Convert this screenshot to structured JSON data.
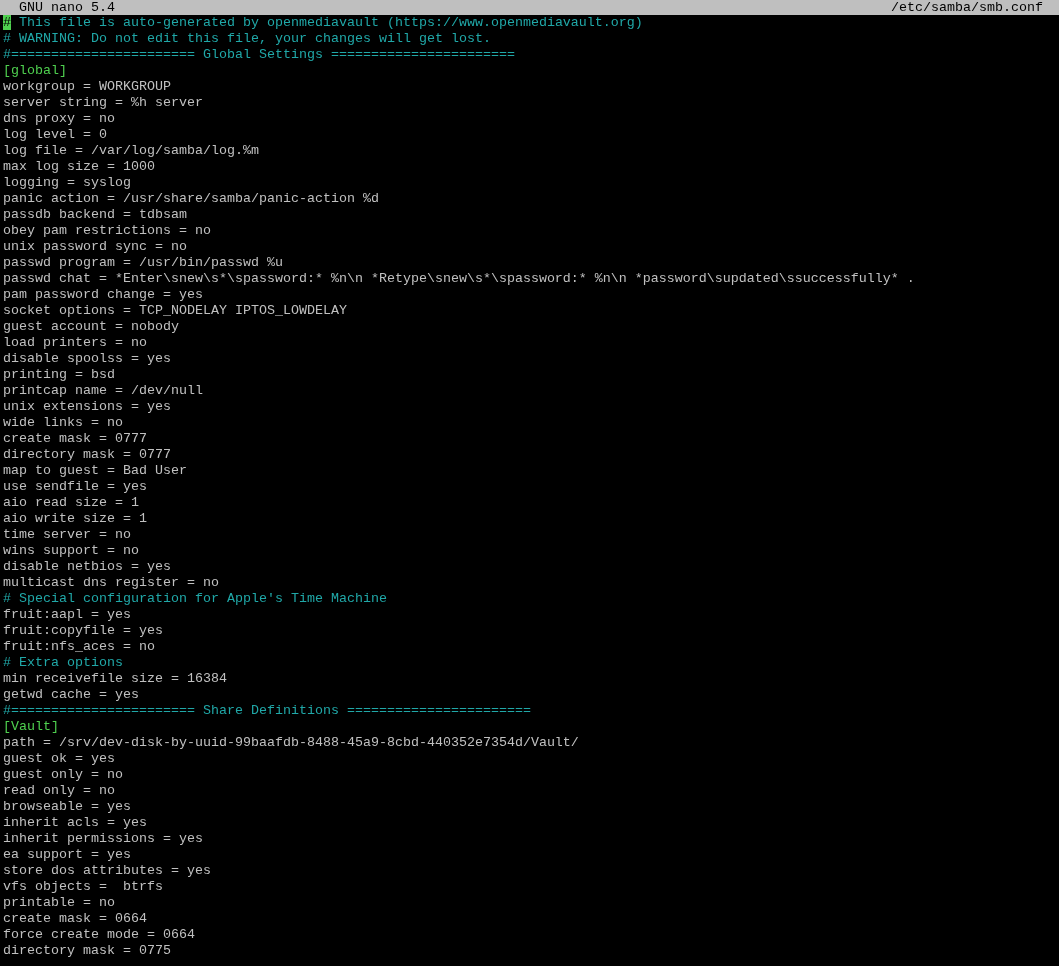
{
  "title_bar": {
    "program": "GNU nano 5.4",
    "file": "/etc/samba/smb.conf"
  },
  "lines": [
    {
      "kind": "comment",
      "text": "# This file is auto-generated by openmediavault (https://www.openmediavault.org)",
      "cursor": true
    },
    {
      "kind": "comment",
      "text": "# WARNING: Do not edit this file, your changes will get lost.",
      "cursor": false
    },
    {
      "kind": "comment",
      "text": "#======================= Global Settings =======================",
      "cursor": false
    },
    {
      "kind": "section",
      "text": "[global]",
      "cursor": false
    },
    {
      "kind": "setting",
      "text": "workgroup = WORKGROUP",
      "cursor": false
    },
    {
      "kind": "setting",
      "text": "server string = %h server",
      "cursor": false
    },
    {
      "kind": "setting",
      "text": "dns proxy = no",
      "cursor": false
    },
    {
      "kind": "setting",
      "text": "log level = 0",
      "cursor": false
    },
    {
      "kind": "setting",
      "text": "log file = /var/log/samba/log.%m",
      "cursor": false
    },
    {
      "kind": "setting",
      "text": "max log size = 1000",
      "cursor": false
    },
    {
      "kind": "setting",
      "text": "logging = syslog",
      "cursor": false
    },
    {
      "kind": "setting",
      "text": "panic action = /usr/share/samba/panic-action %d",
      "cursor": false
    },
    {
      "kind": "setting",
      "text": "passdb backend = tdbsam",
      "cursor": false
    },
    {
      "kind": "setting",
      "text": "obey pam restrictions = no",
      "cursor": false
    },
    {
      "kind": "setting",
      "text": "unix password sync = no",
      "cursor": false
    },
    {
      "kind": "setting",
      "text": "passwd program = /usr/bin/passwd %u",
      "cursor": false
    },
    {
      "kind": "setting",
      "text": "passwd chat = *Enter\\snew\\s*\\spassword:* %n\\n *Retype\\snew\\s*\\spassword:* %n\\n *password\\supdated\\ssuccessfully* .",
      "cursor": false
    },
    {
      "kind": "setting",
      "text": "pam password change = yes",
      "cursor": false
    },
    {
      "kind": "setting",
      "text": "socket options = TCP_NODELAY IPTOS_LOWDELAY",
      "cursor": false
    },
    {
      "kind": "setting",
      "text": "guest account = nobody",
      "cursor": false
    },
    {
      "kind": "setting",
      "text": "load printers = no",
      "cursor": false
    },
    {
      "kind": "setting",
      "text": "disable spoolss = yes",
      "cursor": false
    },
    {
      "kind": "setting",
      "text": "printing = bsd",
      "cursor": false
    },
    {
      "kind": "setting",
      "text": "printcap name = /dev/null",
      "cursor": false
    },
    {
      "kind": "setting",
      "text": "unix extensions = yes",
      "cursor": false
    },
    {
      "kind": "setting",
      "text": "wide links = no",
      "cursor": false
    },
    {
      "kind": "setting",
      "text": "create mask = 0777",
      "cursor": false
    },
    {
      "kind": "setting",
      "text": "directory mask = 0777",
      "cursor": false
    },
    {
      "kind": "setting",
      "text": "map to guest = Bad User",
      "cursor": false
    },
    {
      "kind": "setting",
      "text": "use sendfile = yes",
      "cursor": false
    },
    {
      "kind": "setting",
      "text": "aio read size = 1",
      "cursor": false
    },
    {
      "kind": "setting",
      "text": "aio write size = 1",
      "cursor": false
    },
    {
      "kind": "setting",
      "text": "time server = no",
      "cursor": false
    },
    {
      "kind": "setting",
      "text": "wins support = no",
      "cursor": false
    },
    {
      "kind": "setting",
      "text": "disable netbios = yes",
      "cursor": false
    },
    {
      "kind": "setting",
      "text": "multicast dns register = no",
      "cursor": false
    },
    {
      "kind": "comment",
      "text": "# Special configuration for Apple's Time Machine",
      "cursor": false
    },
    {
      "kind": "setting",
      "text": "fruit:aapl = yes",
      "cursor": false
    },
    {
      "kind": "setting",
      "text": "fruit:copyfile = yes",
      "cursor": false
    },
    {
      "kind": "setting",
      "text": "fruit:nfs_aces = no",
      "cursor": false
    },
    {
      "kind": "comment",
      "text": "# Extra options",
      "cursor": false
    },
    {
      "kind": "setting",
      "text": "min receivefile size = 16384",
      "cursor": false
    },
    {
      "kind": "setting",
      "text": "getwd cache = yes",
      "cursor": false
    },
    {
      "kind": "comment",
      "text": "#======================= Share Definitions =======================",
      "cursor": false
    },
    {
      "kind": "section",
      "text": "[Vault]",
      "cursor": false
    },
    {
      "kind": "setting",
      "text": "path = /srv/dev-disk-by-uuid-99baafdb-8488-45a9-8cbd-440352e7354d/Vault/",
      "cursor": false
    },
    {
      "kind": "setting",
      "text": "guest ok = yes",
      "cursor": false
    },
    {
      "kind": "setting",
      "text": "guest only = no",
      "cursor": false
    },
    {
      "kind": "setting",
      "text": "read only = no",
      "cursor": false
    },
    {
      "kind": "setting",
      "text": "browseable = yes",
      "cursor": false
    },
    {
      "kind": "setting",
      "text": "inherit acls = yes",
      "cursor": false
    },
    {
      "kind": "setting",
      "text": "inherit permissions = yes",
      "cursor": false
    },
    {
      "kind": "setting",
      "text": "ea support = yes",
      "cursor": false
    },
    {
      "kind": "setting",
      "text": "store dos attributes = yes",
      "cursor": false
    },
    {
      "kind": "setting",
      "text": "vfs objects =  btrfs",
      "cursor": false
    },
    {
      "kind": "setting",
      "text": "printable = no",
      "cursor": false
    },
    {
      "kind": "setting",
      "text": "create mask = 0664",
      "cursor": false
    },
    {
      "kind": "setting",
      "text": "force create mode = 0664",
      "cursor": false
    },
    {
      "kind": "setting",
      "text": "directory mask = 0775",
      "cursor": false
    }
  ]
}
